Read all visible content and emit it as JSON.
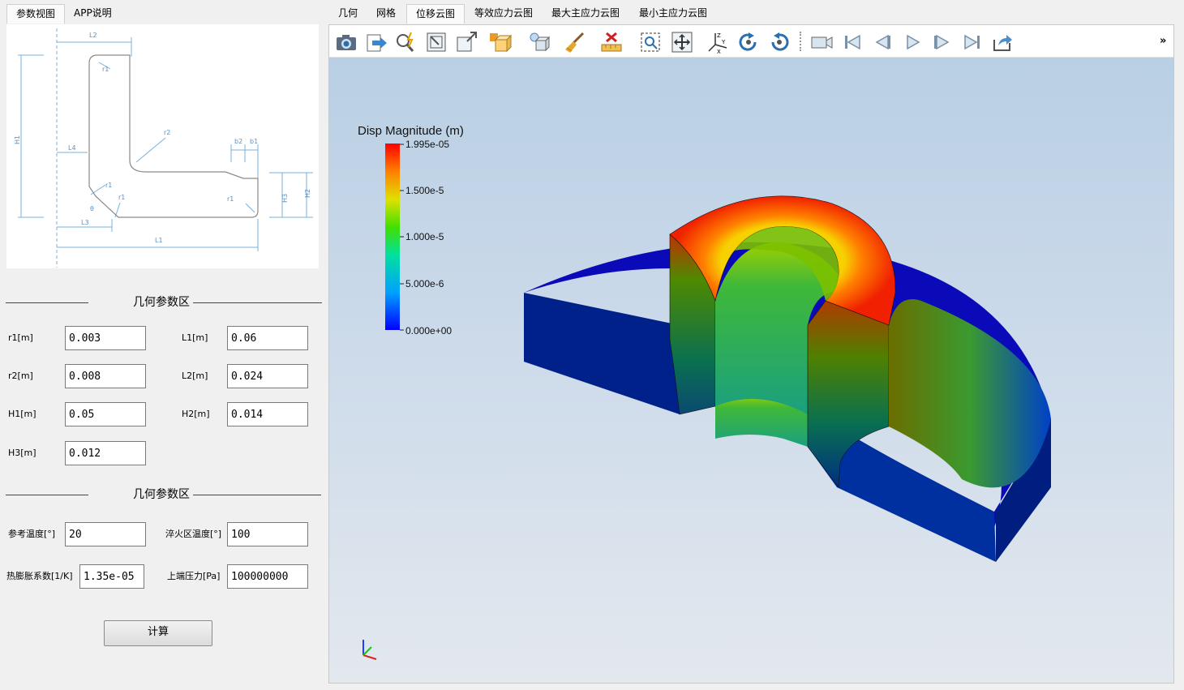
{
  "left_tabs": [
    "参数视图",
    "APP说明"
  ],
  "right_tabs": [
    "几何",
    "网格",
    "位移云图",
    "等效应力云图",
    "最大主应力云图",
    "最小主应力云图"
  ],
  "sketch": {
    "labels": {
      "L1": "L1",
      "L2": "L2",
      "L3": "L3",
      "L4": "L4",
      "H1": "H1",
      "H2": "H2",
      "H3": "H3",
      "b1": "b1",
      "b2": "b2",
      "r1": "r1",
      "r2": "r2",
      "theta": "θ"
    }
  },
  "section_geometry": {
    "title": "几何参数区"
  },
  "section_material": {
    "title": "几何参数区"
  },
  "params": {
    "r1": {
      "label": "r1[m]",
      "value": "0.003"
    },
    "L1": {
      "label": "L1[m]",
      "value": "0.06"
    },
    "r2": {
      "label": "r2[m]",
      "value": "0.008"
    },
    "L2": {
      "label": "L2[m]",
      "value": "0.024"
    },
    "H1": {
      "label": "H1[m]",
      "value": "0.05"
    },
    "H2": {
      "label": "H2[m]",
      "value": "0.014"
    },
    "H3": {
      "label": "H3[m]",
      "value": "0.012"
    },
    "ref_temp": {
      "label": "参考温度[°]",
      "value": "20"
    },
    "quench_temp": {
      "label": "淬火区温度[°]",
      "value": "100"
    },
    "expansion": {
      "label": "热膨胀系数[1/K]",
      "value": "1.35e-05"
    },
    "top_pressure": {
      "label": "上端压力[Pa]",
      "value": "100000000"
    }
  },
  "calc_button": "计算",
  "toolbar": {
    "icons": [
      "camera-icon",
      "export-icon",
      "pick-icon",
      "fit-view-icon",
      "zoom-box-icon",
      "cube-view-icon",
      "light-icon",
      "brush-icon",
      "ruler-icon",
      "select-box-icon",
      "pan-icon",
      "axes-icon",
      "rotate-cw-icon",
      "rotate-ccw-icon",
      "video-icon",
      "first-frame-icon",
      "prev-frame-icon",
      "play-icon",
      "next-frame-icon",
      "last-frame-icon",
      "share-icon"
    ],
    "overflow": "»"
  },
  "colorbar": {
    "title": "Disp Magnitude (m)",
    "ticks": [
      "1.995e-05",
      "1.500e-5",
      "1.000e-5",
      "5.000e-6",
      "0.000e+00"
    ],
    "min": 0,
    "max": 1.995e-05,
    "colors": [
      "#0000ff",
      "#00c8ff",
      "#00e070",
      "#c8e600",
      "#ff8000",
      "#ff0000"
    ]
  }
}
